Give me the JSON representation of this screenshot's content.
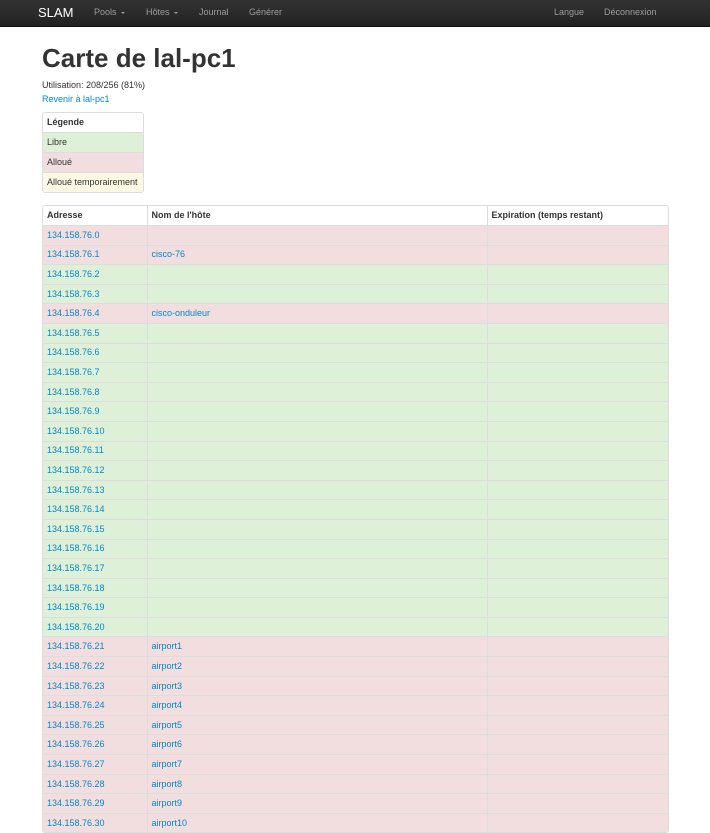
{
  "navbar": {
    "brand": "SLAM",
    "pools": "Pools",
    "hosts": "Hôtes",
    "journal": "Journal",
    "generate": "Générer",
    "language": "Langue",
    "logout": "Déconnexion"
  },
  "page": {
    "title": "Carte de lal-pc1",
    "usage": "Utilisation: 208/256 (81%)",
    "back_link": "Revenir à lal-pc1"
  },
  "legend": {
    "header": "Légende",
    "free": "Libre",
    "allocated": "Alloué",
    "temporary": "Alloué temporairement",
    "colors": {
      "free": "#dff0d8",
      "allocated": "#f2dede",
      "temporary": "#fcf8e3"
    }
  },
  "table": {
    "headers": [
      "Adresse",
      "Nom de l'hôte",
      "Expiration (temps restant)"
    ],
    "rows": [
      {
        "address": "134.158.76.0",
        "host": "",
        "status": "alloc"
      },
      {
        "address": "134.158.76.1",
        "host": "cisco-76",
        "status": "alloc"
      },
      {
        "address": "134.158.76.2",
        "host": "",
        "status": "free"
      },
      {
        "address": "134.158.76.3",
        "host": "",
        "status": "free"
      },
      {
        "address": "134.158.76.4",
        "host": "cisco-onduleur",
        "status": "alloc"
      },
      {
        "address": "134.158.76.5",
        "host": "",
        "status": "free"
      },
      {
        "address": "134.158.76.6",
        "host": "",
        "status": "free"
      },
      {
        "address": "134.158.76.7",
        "host": "",
        "status": "free"
      },
      {
        "address": "134.158.76.8",
        "host": "",
        "status": "free"
      },
      {
        "address": "134.158.76.9",
        "host": "",
        "status": "free"
      },
      {
        "address": "134.158.76.10",
        "host": "",
        "status": "free"
      },
      {
        "address": "134.158.76.11",
        "host": "",
        "status": "free"
      },
      {
        "address": "134.158.76.12",
        "host": "",
        "status": "free"
      },
      {
        "address": "134.158.76.13",
        "host": "",
        "status": "free"
      },
      {
        "address": "134.158.76.14",
        "host": "",
        "status": "free"
      },
      {
        "address": "134.158.76.15",
        "host": "",
        "status": "free"
      },
      {
        "address": "134.158.76.16",
        "host": "",
        "status": "free"
      },
      {
        "address": "134.158.76.17",
        "host": "",
        "status": "free"
      },
      {
        "address": "134.158.76.18",
        "host": "",
        "status": "free"
      },
      {
        "address": "134.158.76.19",
        "host": "",
        "status": "free"
      },
      {
        "address": "134.158.76.20",
        "host": "",
        "status": "free"
      },
      {
        "address": "134.158.76.21",
        "host": "airport1",
        "status": "alloc"
      },
      {
        "address": "134.158.76.22",
        "host": "airport2",
        "status": "alloc"
      },
      {
        "address": "134.158.76.23",
        "host": "airport3",
        "status": "alloc"
      },
      {
        "address": "134.158.76.24",
        "host": "airport4",
        "status": "alloc"
      },
      {
        "address": "134.158.76.25",
        "host": "airport5",
        "status": "alloc"
      },
      {
        "address": "134.158.76.26",
        "host": "airport6",
        "status": "alloc"
      },
      {
        "address": "134.158.76.27",
        "host": "airport7",
        "status": "alloc"
      },
      {
        "address": "134.158.76.28",
        "host": "airport8",
        "status": "alloc"
      },
      {
        "address": "134.158.76.29",
        "host": "airport9",
        "status": "alloc"
      },
      {
        "address": "134.158.76.30",
        "host": "airport10",
        "status": "alloc"
      }
    ]
  }
}
